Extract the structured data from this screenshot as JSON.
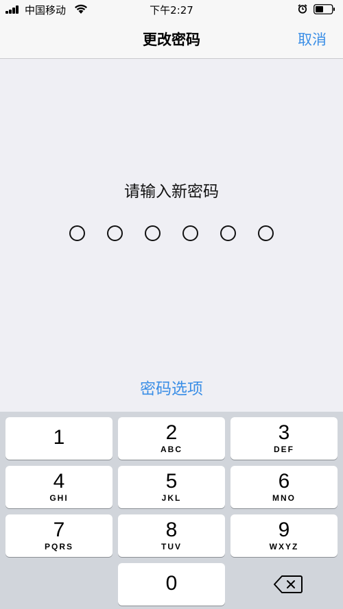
{
  "status_bar": {
    "carrier": "中国移动",
    "time": "下午2:27"
  },
  "nav": {
    "title": "更改密码",
    "cancel_label": "取消"
  },
  "passcode": {
    "prompt": "请输入新密码",
    "digit_count": 6,
    "digits_entered": 0
  },
  "options_label": "密码选项",
  "keypad": {
    "keys": [
      {
        "number": "1",
        "letters": ""
      },
      {
        "number": "2",
        "letters": "ABC"
      },
      {
        "number": "3",
        "letters": "DEF"
      },
      {
        "number": "4",
        "letters": "GHI"
      },
      {
        "number": "5",
        "letters": "JKL"
      },
      {
        "number": "6",
        "letters": "MNO"
      },
      {
        "number": "7",
        "letters": "PQRS"
      },
      {
        "number": "8",
        "letters": "TUV"
      },
      {
        "number": "9",
        "letters": "WXYZ"
      },
      {
        "number": "0",
        "letters": ""
      }
    ]
  },
  "colors": {
    "accent": "#3a8ee6",
    "background": "#efeff4",
    "keypad_bg": "#d1d5db"
  }
}
